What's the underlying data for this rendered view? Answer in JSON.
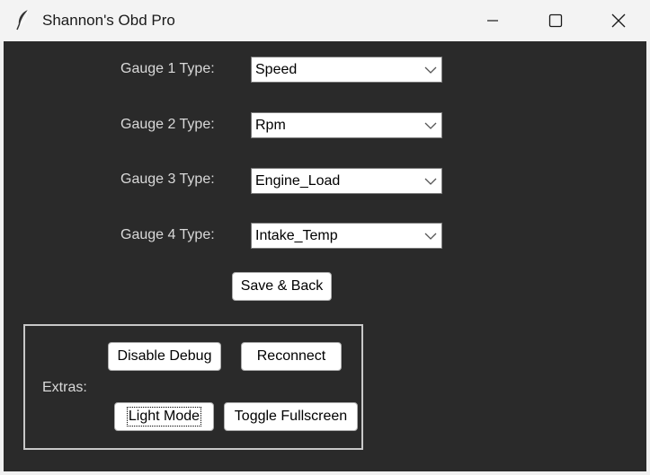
{
  "window": {
    "title": "Shannon's Obd Pro"
  },
  "gauges": [
    {
      "label": "Gauge 1 Type:",
      "value": "Speed"
    },
    {
      "label": "Gauge 2 Type:",
      "value": "Rpm"
    },
    {
      "label": "Gauge 3 Type:",
      "value": "Engine_Load"
    },
    {
      "label": "Gauge 4 Type:",
      "value": "Intake_Temp"
    }
  ],
  "save_back_label": "Save & Back",
  "extras": {
    "label": "Extras:",
    "disable_debug_label": "Disable Debug",
    "reconnect_label": "Reconnect",
    "light_mode_label": "Light Mode",
    "toggle_fullscreen_label": "Toggle Fullscreen"
  },
  "icons": {
    "app": "feather-icon",
    "minimize": "minimize-icon",
    "maximize": "maximize-icon",
    "close": "close-icon",
    "dropdown": "chevron-down-icon"
  },
  "colors": {
    "client_background": "#2a2a2a",
    "label_text": "#d9d9d9",
    "titlebar": "#f3f3f3"
  }
}
